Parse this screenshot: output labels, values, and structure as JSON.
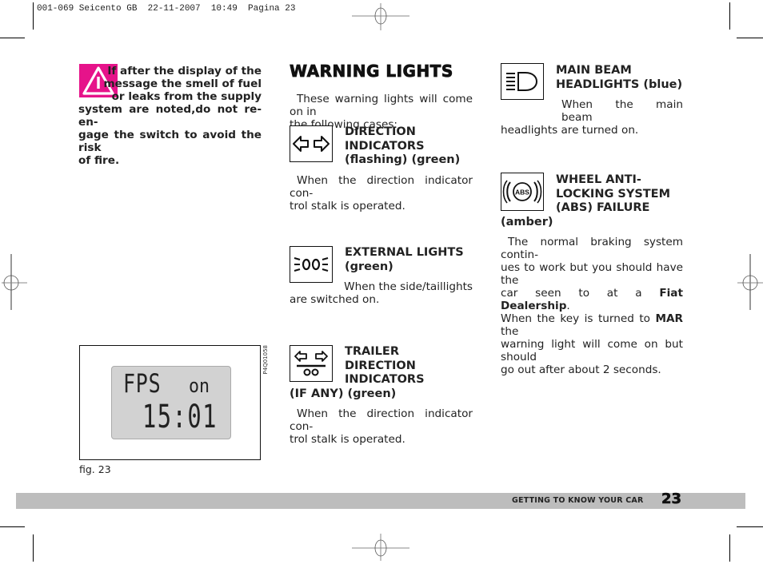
{
  "print_slug": "001-069 Seicento GB  22-11-2007  10:49  Pagina 23",
  "warning_note": {
    "icon": "warning-triangle-icon",
    "accent_color": "#e6138a",
    "text": "If after the display of the message the smell of fuel or leaks from the supply system are noted,do not re-engage the switch to avoid the risk of fire.",
    "lines": [
      "If after the display of the",
      "message the smell of fuel",
      "or leaks from the supply",
      "system are noted,do not re-en-",
      "gage the switch to avoid the risk",
      "of fire."
    ]
  },
  "figure": {
    "display_line1_left": "FPS",
    "display_line1_right": "on",
    "display_line2": "15:01",
    "code": "P4Q01058",
    "caption": "fig. 23"
  },
  "section": {
    "title": "WARNING LIGHTS",
    "intro_lines": [
      "These warning lights will come on in",
      "the following cases:"
    ]
  },
  "lights": [
    {
      "icon": "direction-indicators-icon",
      "heading_lines": [
        "DIRECTION",
        "INDICATORS",
        "(flashing) (green)"
      ],
      "body_lines": [
        "When the direction indicator con-",
        "trol stalk is operated."
      ]
    },
    {
      "icon": "external-lights-icon",
      "heading_lines": [
        "EXTERNAL LIGHTS",
        "(green)"
      ],
      "body_lines": [
        "When the side/taillights",
        "are switched on."
      ]
    },
    {
      "icon": "trailer-direction-indicators-icon",
      "heading_lines": [
        "TRAILER",
        "DIRECTION",
        "INDICATORS",
        "(IF ANY) (green)"
      ],
      "body_lines": [
        "When the direction indicator con-",
        "trol stalk is operated."
      ]
    },
    {
      "icon": "main-beam-headlights-icon",
      "heading_lines": [
        "MAIN BEAM",
        "HEADLIGHTS (blue)"
      ],
      "body_lines": [
        "When the main beam",
        "headlights are turned on."
      ]
    },
    {
      "icon": "abs-failure-icon",
      "icon_label": "ABS",
      "heading_lines": [
        "WHEEL ANTI-",
        "LOCKING SYSTEM",
        "(ABS) FAILURE",
        "(amber)"
      ],
      "body_lines": [
        "The normal braking system contin-",
        "ues to work but you should have the",
        "car seen to at a",
        "Fiat Dealership",
        ".",
        "When the key is turned to",
        "MAR",
        "the",
        "warning light will come on but should",
        "go out after about 2 seconds."
      ]
    }
  ],
  "footer": {
    "section_label": "GETTING TO KNOW YOUR CAR",
    "page_number": "23",
    "bar_color": "#bdbdbd"
  }
}
